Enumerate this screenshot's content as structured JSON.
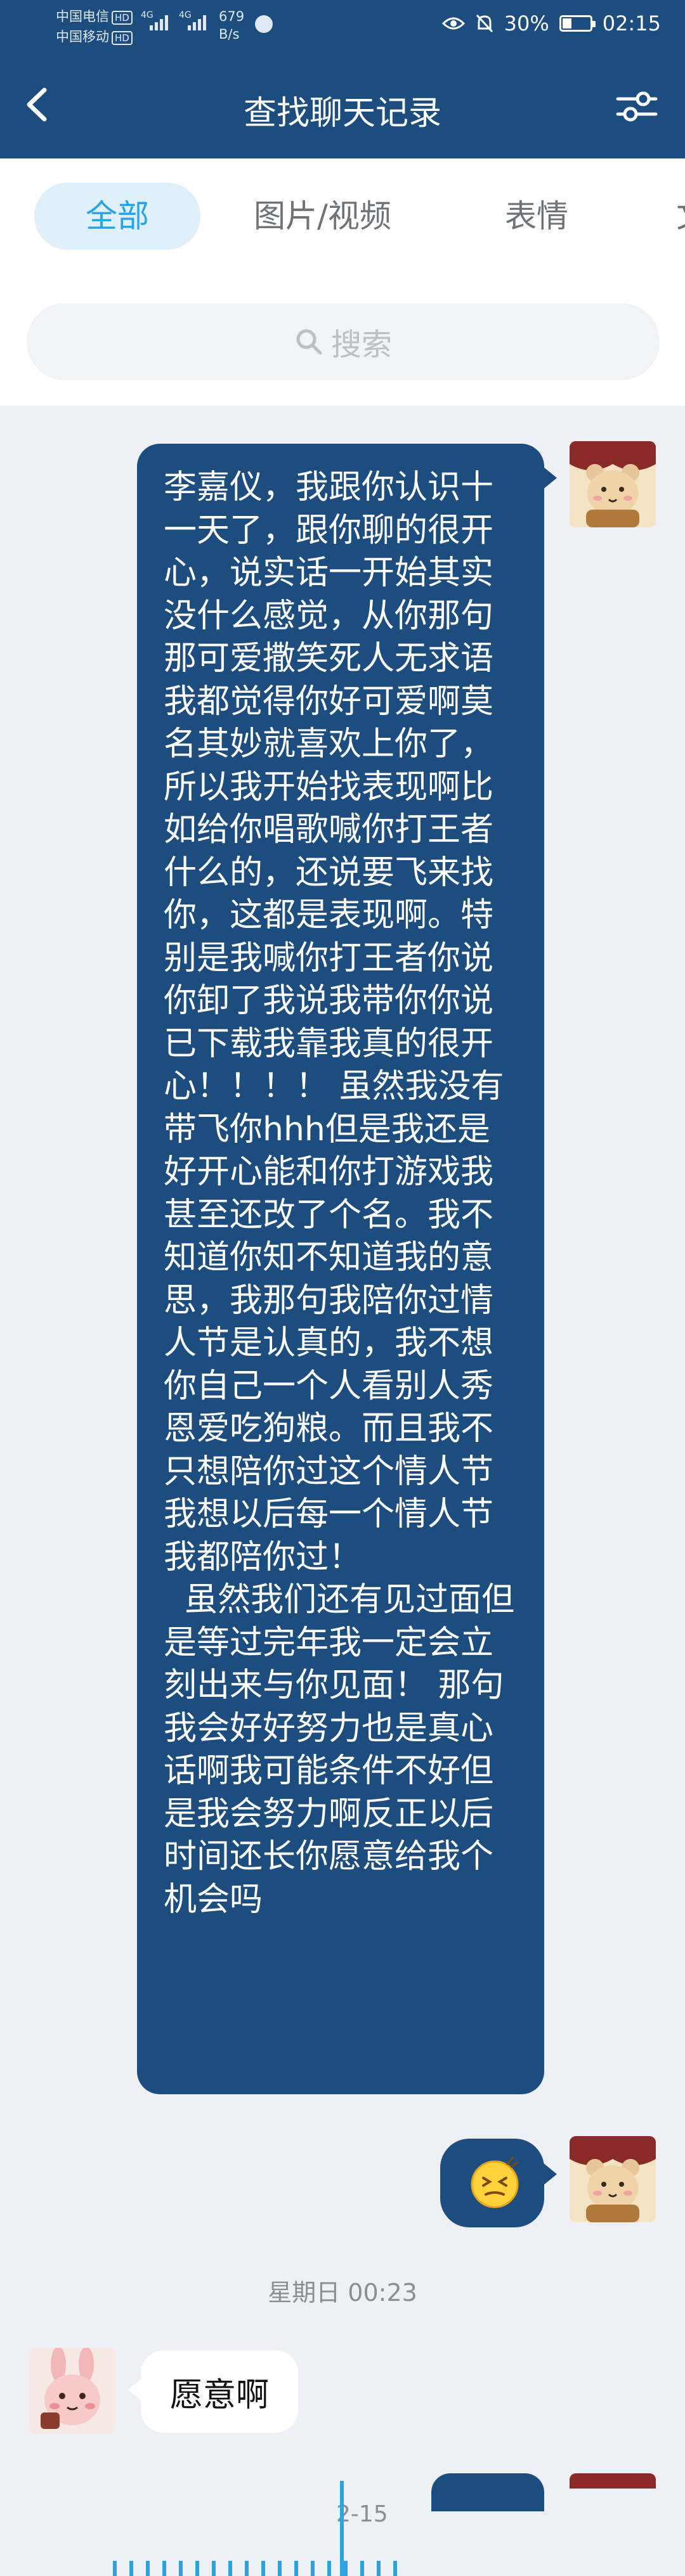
{
  "status_bar": {
    "carrier_1": "中国电信",
    "carrier_2": "中国移动",
    "hd_label": "HD",
    "network_label": "4G",
    "speed_value": "679",
    "speed_unit": "B/s",
    "battery_percent": "30%",
    "time": "02:15"
  },
  "header": {
    "title": "查找聊天记录",
    "back_icon": "chevron-left-icon",
    "filter_icon": "sliders-icon",
    "background_color": "#1d4d7e"
  },
  "tabs": [
    {
      "label": "全部",
      "active": true
    },
    {
      "label": "图片/视频",
      "active": false
    },
    {
      "label": "表情",
      "active": false
    },
    {
      "label": "文",
      "active": false
    }
  ],
  "search": {
    "placeholder": "搜索",
    "icon": "search-icon"
  },
  "messages": [
    {
      "direction": "outgoing",
      "type": "text",
      "text": "李嘉仪，我跟你认识十一天了，跟你聊的很开心，说实话一开始其实没什么感觉，从你那句那可爱撒笑死人无求语我都觉得你好可爱啊莫名其妙就喜欢上你了，所以我开始找表现啊比如给你唱歌喊你打王者什么的，还说要飞来找你，这都是表现啊。特别是我喊你打王者你说你卸了我说我带你你说已下载我靠我真的很开心！！！！ 虽然我没有带飞你hhh但是我还是好开心能和你打游戏我甚至还改了个名。我不知道你知不知道我的意思，我那句我陪你过情人节是认真的，我不想你自己一个人看别人秀恩爱吃狗粮。而且我不只想陪你过这个情人节我想以后每一个情人节我都陪你过！\n  虽然我们还有见过面但是等过完年我一定会立刻出来与你见面！ 那句我会好好努力也是真心话啊我可能条件不好但是我会努力啊反正以后时间还长你愿意给我个机会吗",
      "avatar": "bear-avatar"
    },
    {
      "direction": "outgoing",
      "type": "emoji",
      "emoji": "embarrassed-face-icon",
      "avatar": "bear-avatar"
    },
    {
      "direction": "incoming",
      "type": "text",
      "text": "愿意啊",
      "avatar": "rabbit-avatar"
    }
  ],
  "time_divider": "星期日 00:23",
  "timeline": {
    "label": "2-15",
    "accent_color": "#2ea3e0"
  }
}
